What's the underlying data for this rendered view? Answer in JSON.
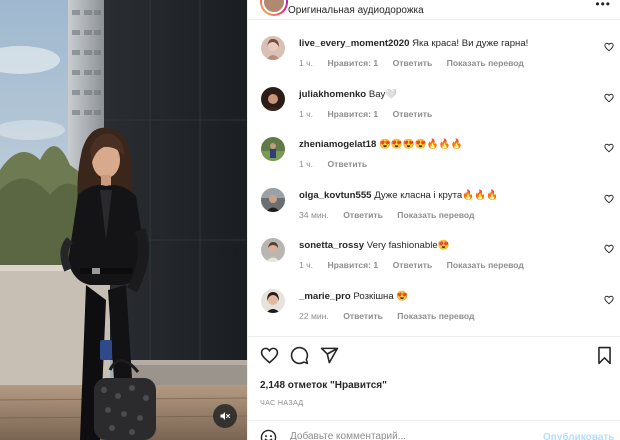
{
  "header": {
    "audio_label": "Оригинальная аудиодорожка",
    "more_label": "•••"
  },
  "comments": [
    {
      "username": "live_every_moment2020",
      "text": "Яка краса! Ви дуже гарна!",
      "time": "1 ч.",
      "likes": "Нравится: 1",
      "reply": "Ответить",
      "translate": "Показать перевод"
    },
    {
      "username": "juliakhomenko",
      "text": "Вау🤍",
      "time": "1 ч.",
      "likes": "Нравится: 1",
      "reply": "Ответить",
      "translate": ""
    },
    {
      "username": "zheniamogelat18",
      "text": "😍😍😍😍🔥🔥🔥",
      "time": "1 ч.",
      "likes": "",
      "reply": "Ответить",
      "translate": ""
    },
    {
      "username": "olga_kovtun555",
      "text": "Дуже класна і крута🔥🔥🔥",
      "time": "34 мин.",
      "likes": "",
      "reply": "Ответить",
      "translate": "Показать перевод"
    },
    {
      "username": "sonetta_rossy",
      "text": "Very fashionable😍",
      "time": "1 ч.",
      "likes": "Нравится: 1",
      "reply": "Ответить",
      "translate": "Показать перевод"
    },
    {
      "username": "_marie_pro",
      "text": "Розкішна 😍",
      "time": "22 мин.",
      "likes": "",
      "reply": "Ответить",
      "translate": "Показать перевод"
    }
  ],
  "likes_count": "2,148 отметок \"Нравится\"",
  "time_ago": "ЧАС НАЗАД",
  "add_comment": {
    "placeholder": "Добавьте комментарий...",
    "publish_label": "Опубликовать"
  },
  "colors": {
    "text": "#262626",
    "muted": "#8e8e8e",
    "link_disabled": "#b2dffc",
    "border": "#efefef"
  },
  "icons": {
    "comment_like": "heart-outline-icon",
    "like": "heart-outline-icon",
    "comment": "speech-bubble-icon",
    "share": "paper-plane-icon",
    "save": "bookmark-icon",
    "mute": "speaker-muted-icon",
    "emoji": "smiley-icon"
  }
}
